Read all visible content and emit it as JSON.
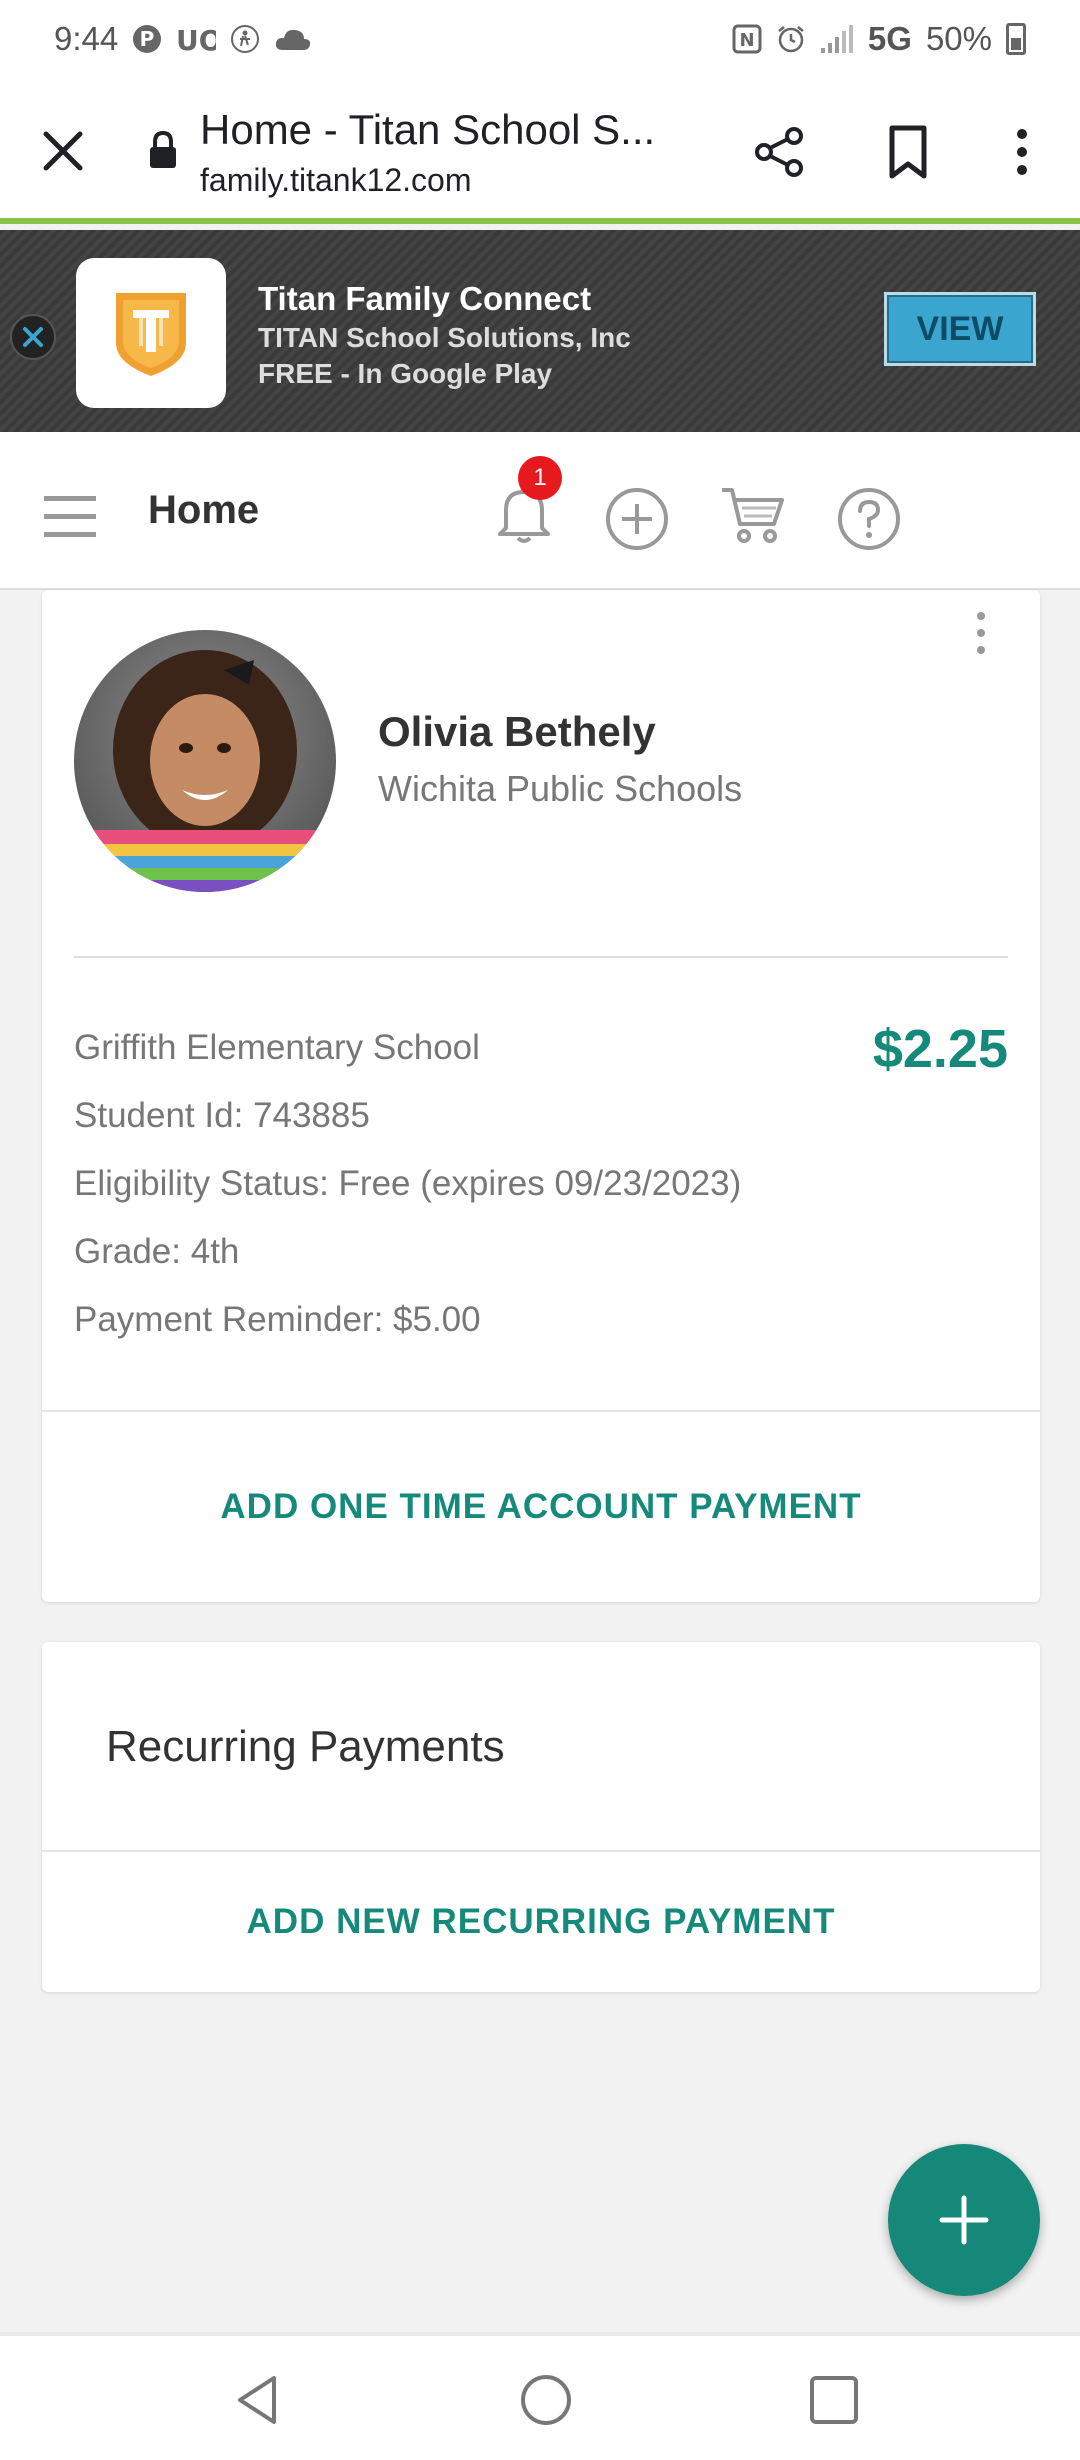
{
  "status_bar": {
    "time": "9:44",
    "network": "5G",
    "battery": "50%",
    "icons": [
      "pinterest-icon",
      "uo-icon",
      "accessibility-icon",
      "cloud-icon",
      "nfc-icon",
      "alarm-icon",
      "signal-icon",
      "battery-icon"
    ]
  },
  "browser": {
    "title": "Home - Titan School S...",
    "url": "family.titank12.com"
  },
  "app_banner": {
    "app_name": "Titan Family Connect",
    "company": "TITAN School Solutions, Inc",
    "price": "FREE - In Google Play",
    "view_label": "VIEW"
  },
  "header": {
    "title": "Home",
    "notification_count": "1"
  },
  "student": {
    "name": "Olivia Bethely",
    "district": "Wichita Public Schools",
    "school": "Griffith Elementary School",
    "balance": "$2.25",
    "student_id": "Student Id: 743885",
    "eligibility": "Eligibility Status: Free (expires 09/23/2023)",
    "grade": "Grade: 4th",
    "payment_reminder": "Payment Reminder: $5.00",
    "action_label": "ADD ONE TIME ACCOUNT PAYMENT"
  },
  "recurring": {
    "title": "Recurring Payments",
    "action_label": "ADD NEW RECURRING PAYMENT"
  },
  "colors": {
    "accent": "#168a7a",
    "badge": "#e5191e",
    "browser_line": "#8bc34a",
    "view_button": "#3aa6d0"
  }
}
